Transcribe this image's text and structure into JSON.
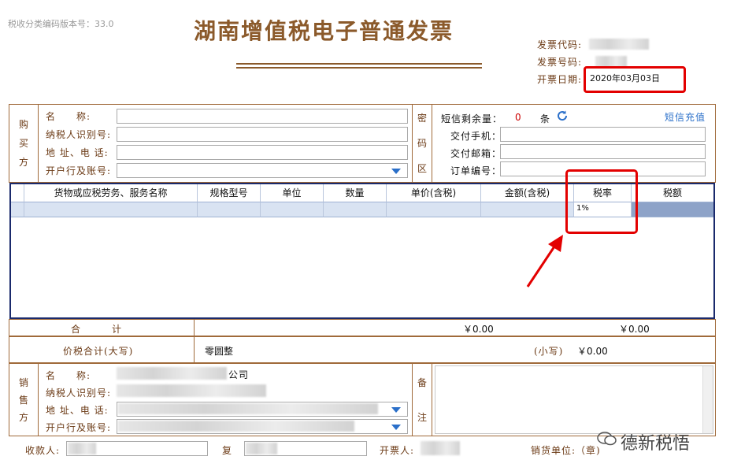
{
  "header": {
    "version_label": "税收分类编码版本号：33.0",
    "title": "湖南增值税电子普通发票",
    "invoice_code_label": "发票代码:",
    "invoice_number_label": "发票号码:",
    "issue_date_label": "开票日期:",
    "issue_date_value": "2020年03月03日"
  },
  "buyer": {
    "section_label": [
      "购",
      "买",
      "方"
    ],
    "name_label": "名　　称:",
    "tax_id_label": "纳税人识别号:",
    "address_label": "地  址、电  话:",
    "bank_label": "开户行及账号:"
  },
  "cipher": {
    "section_label": [
      "密",
      "码",
      "区"
    ],
    "sms_remaining_label": "短信剩余量：",
    "sms_remaining_value": "0",
    "sms_unit": "条",
    "sms_recharge_link": "短信充值",
    "delivery_phone_label": "交付手机：",
    "delivery_email_label": "交付邮箱：",
    "order_number_label": "订单编号："
  },
  "items_table": {
    "columns": [
      "货物或应税劳务、服务名称",
      "规格型号",
      "单位",
      "数量",
      "单价(含税)",
      "金额(含税)",
      "税率",
      "税额"
    ],
    "rows": [
      {
        "name": "",
        "spec": "",
        "unit": "",
        "qty": "",
        "price": "",
        "amount": "",
        "tax_rate": "1%",
        "tax": ""
      }
    ]
  },
  "totals": {
    "total_label": "合　　　计",
    "total_amount": "￥0.00",
    "total_tax": "￥0.00",
    "grand_total_label": "价税合计(大写)",
    "grand_total_words": "零圆整",
    "small_label": "(小写)",
    "grand_total_small": "￥0.00"
  },
  "seller": {
    "section_label": [
      "销",
      "售",
      "方"
    ],
    "name_label": "名　　称:",
    "tax_id_label": "纳税人识别号:",
    "address_label": "地  址、电  话:",
    "bank_label": "开户行及账号:",
    "name_value_partial": "公司"
  },
  "remarks": {
    "section_label": [
      "备",
      "注"
    ]
  },
  "footer": {
    "payee_label": "收款人:",
    "reviewer_label": "复",
    "issuer_label": "开票人:",
    "seller_seal_label": "销货单位:（章)"
  },
  "watermark": {
    "text": "德新税悟"
  },
  "colors": {
    "accent_brown": "#8b5a2b",
    "highlight_red": "#e30000",
    "table_border_blue": "#1a2a6c",
    "link_blue": "#2a6fc9"
  }
}
